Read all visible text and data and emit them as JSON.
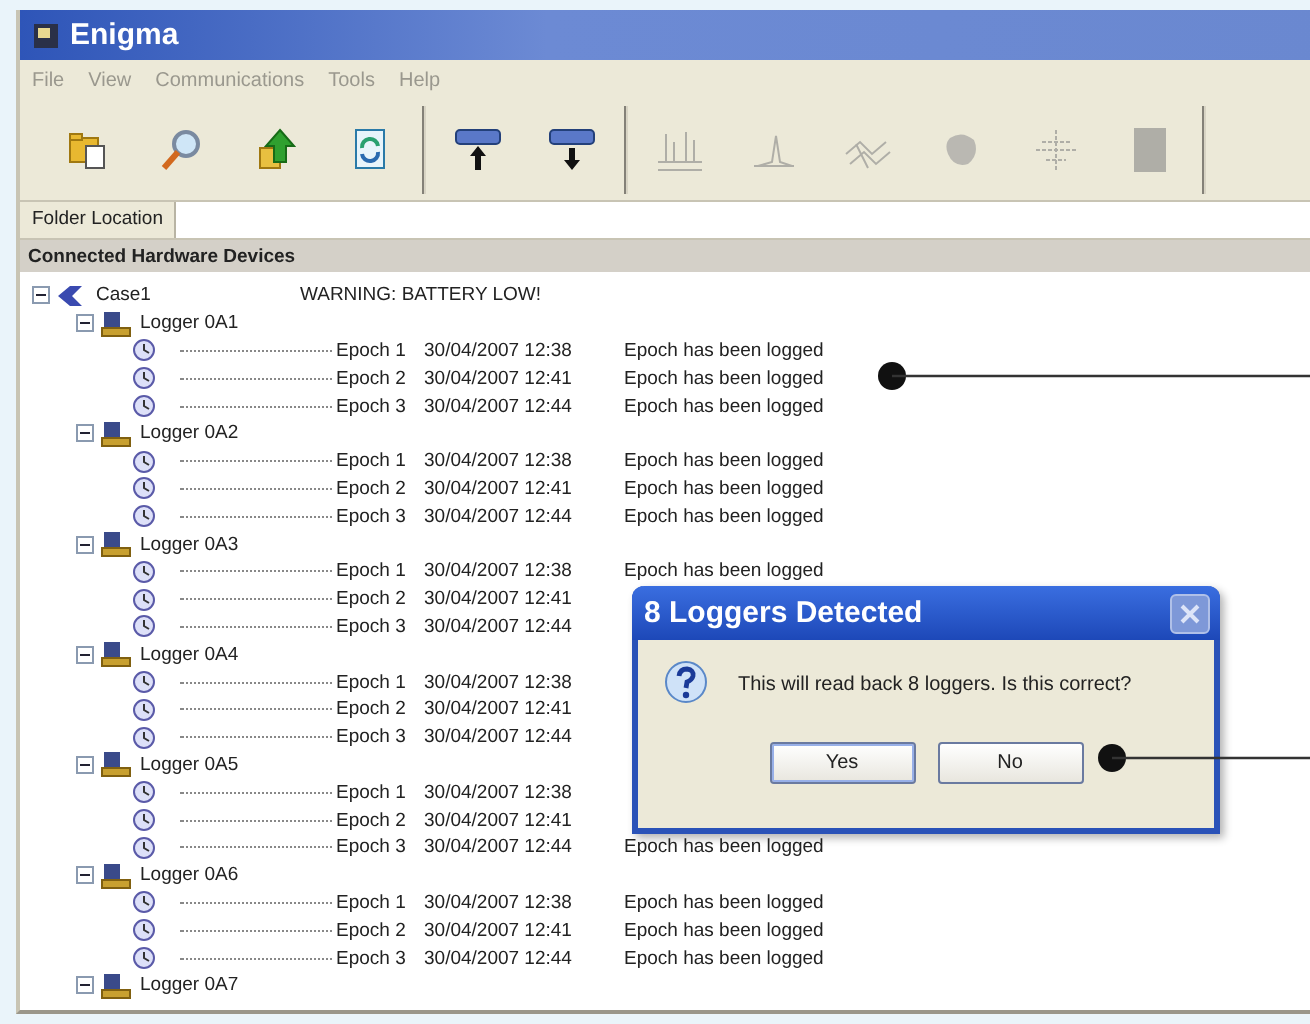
{
  "window": {
    "title": "Enigma"
  },
  "menu": [
    "File",
    "View",
    "Communications",
    "Tools",
    "Help"
  ],
  "toolbar": [
    {
      "kind": "open-folder",
      "disabled": false
    },
    {
      "kind": "search",
      "disabled": false
    },
    {
      "kind": "upload",
      "disabled": false
    },
    {
      "kind": "refresh",
      "disabled": false
    },
    {
      "kind": "logger-up",
      "disabled": false
    },
    {
      "kind": "logger-down",
      "disabled": false
    },
    {
      "kind": "spectrum",
      "disabled": true
    },
    {
      "kind": "peak",
      "disabled": true
    },
    {
      "kind": "waves",
      "disabled": true
    },
    {
      "kind": "blob",
      "disabled": true
    },
    {
      "kind": "crossplot",
      "disabled": true
    },
    {
      "kind": "panel",
      "disabled": true
    }
  ],
  "folder_location": {
    "label": "Folder Location"
  },
  "panel": {
    "title": "Connected Hardware Devices"
  },
  "tree": [
    {
      "label": "Case1",
      "status": "WARNING: BATTERY LOW!",
      "expanded": true,
      "children": [
        {
          "label": "Logger 0A1",
          "expanded": true,
          "children": [
            {
              "label": "Epoch 1",
              "date": "30/04/2007 12:38",
              "message": "Epoch has been logged"
            },
            {
              "label": "Epoch 2",
              "date": "30/04/2007 12:41",
              "message": "Epoch has been logged"
            },
            {
              "label": "Epoch 3",
              "date": "30/04/2007 12:44",
              "message": "Epoch has been logged"
            }
          ]
        },
        {
          "label": "Logger 0A2",
          "expanded": true,
          "children": [
            {
              "label": "Epoch 1",
              "date": "30/04/2007 12:38",
              "message": "Epoch has been logged"
            },
            {
              "label": "Epoch 2",
              "date": "30/04/2007 12:41",
              "message": "Epoch has been logged"
            },
            {
              "label": "Epoch 3",
              "date": "30/04/2007 12:44",
              "message": "Epoch has been logged"
            }
          ]
        },
        {
          "label": "Logger 0A3",
          "expanded": true,
          "children": [
            {
              "label": "Epoch 1",
              "date": "30/04/2007 12:38",
              "message": "Epoch has been logged"
            },
            {
              "label": "Epoch 2",
              "date": "30/04/2007 12:41"
            },
            {
              "label": "Epoch 3",
              "date": "30/04/2007 12:44"
            }
          ]
        },
        {
          "label": "Logger 0A4",
          "expanded": true,
          "children": [
            {
              "label": "Epoch 1",
              "date": "30/04/2007 12:38"
            },
            {
              "label": "Epoch 2",
              "date": "30/04/2007 12:41"
            },
            {
              "label": "Epoch 3",
              "date": "30/04/2007 12:44"
            }
          ]
        },
        {
          "label": "Logger 0A5",
          "expanded": true,
          "children": [
            {
              "label": "Epoch 1",
              "date": "30/04/2007 12:38"
            },
            {
              "label": "Epoch 2",
              "date": "30/04/2007 12:41"
            },
            {
              "label": "Epoch 3",
              "date": "30/04/2007 12:44",
              "message": "Epoch has been logged"
            }
          ]
        },
        {
          "label": "Logger 0A6",
          "expanded": true,
          "children": [
            {
              "label": "Epoch 1",
              "date": "30/04/2007 12:38",
              "message": "Epoch has been logged"
            },
            {
              "label": "Epoch 2",
              "date": "30/04/2007 12:41",
              "message": "Epoch has been logged"
            },
            {
              "label": "Epoch 3",
              "date": "30/04/2007 12:44",
              "message": "Epoch has been logged"
            }
          ]
        },
        {
          "label": "Logger 0A7",
          "expanded": true
        }
      ]
    }
  ],
  "dialog": {
    "title": "8 Loggers Detected",
    "message": "This will read back 8 loggers. Is this correct?",
    "buttons": [
      "Yes",
      "No"
    ]
  }
}
